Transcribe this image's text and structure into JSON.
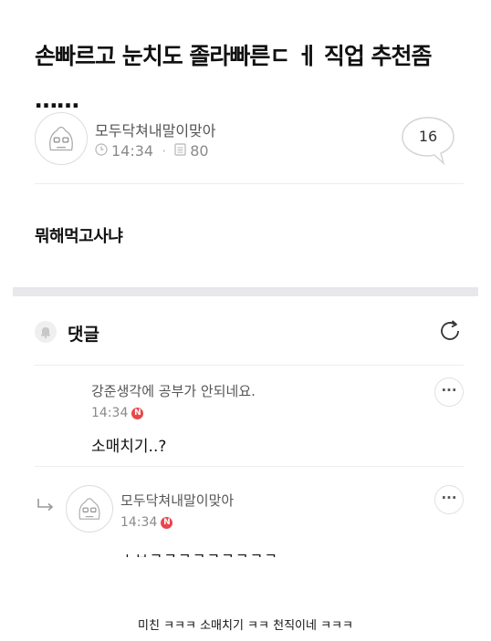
{
  "post": {
    "title": "손빠르고 눈치도 졸라빠른ㄷ ㅔ 직업 추천좀 ……",
    "author": "모두닥쳐내말이맞아",
    "time": "14:34",
    "views": "80",
    "comment_count": "16",
    "body": "뭐해먹고사냐"
  },
  "comments_section": {
    "label": "댓글"
  },
  "comments": [
    {
      "author": "강준생각에 공부가 안되네요.",
      "time": "14:34",
      "badge": "N",
      "text": "소매치기..?"
    },
    {
      "author": "모두닥쳐내말이맞아",
      "time": "14:34",
      "badge": "N",
      "text": "ㅅㅂㅋㅋㅋㅋㅋㅋㅋㅋㅋ"
    }
  ],
  "caption": "미친 ㅋㅋㅋ 소매치기 ㅋㅋ 천직이네 ㅋㅋㅋ",
  "colors": {
    "badge": "#e8464b",
    "divider": "#e8e8eb",
    "meta_text": "#8a8a8a"
  },
  "icons": [
    "avatar-mascot-icon",
    "clock-icon",
    "views-icon",
    "speech-bubble-icon",
    "bell-icon",
    "refresh-icon",
    "more-icon",
    "reply-arrow-icon"
  ]
}
